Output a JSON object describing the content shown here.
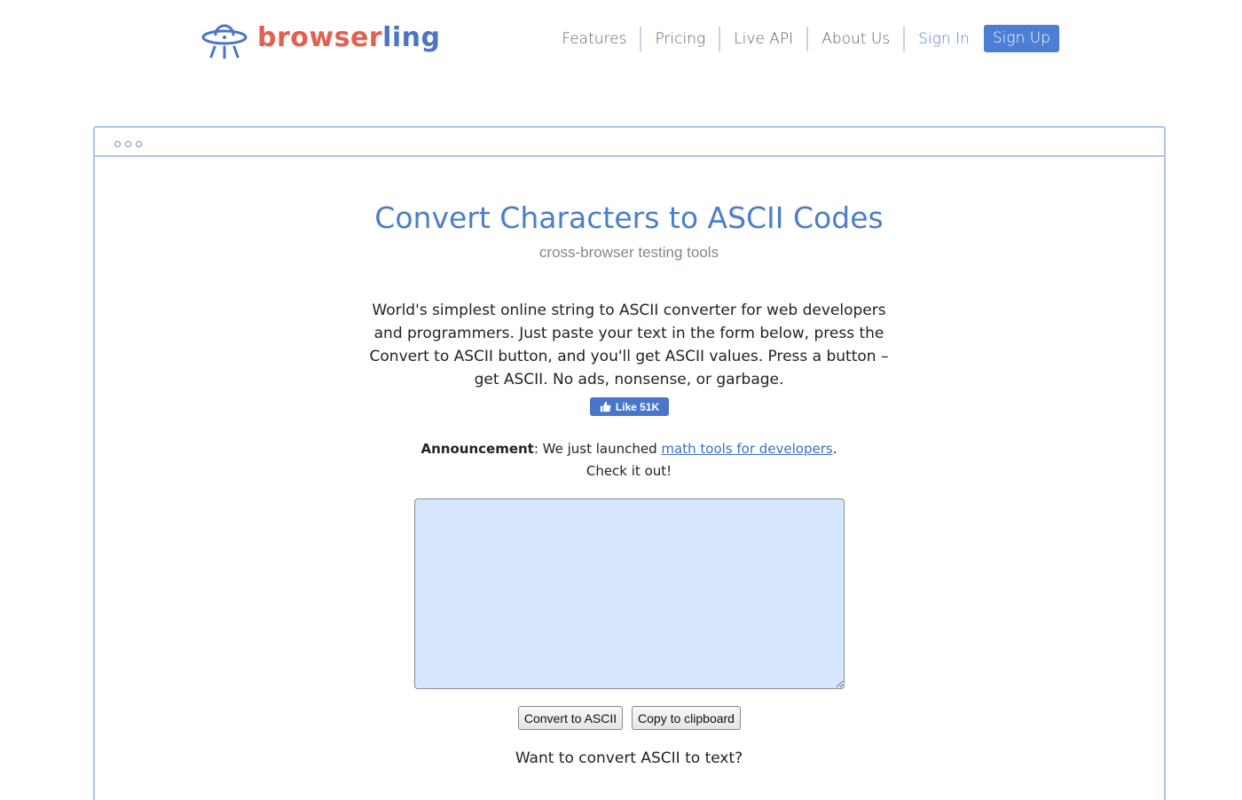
{
  "header": {
    "logo": {
      "part1": "browser",
      "part2": "ling",
      "icon": "ufo-icon"
    },
    "nav": [
      {
        "label": "Features"
      },
      {
        "label": "Pricing"
      },
      {
        "label": "Live API"
      },
      {
        "label": "About Us"
      }
    ],
    "sign_in": "Sign In",
    "sign_up": "Sign Up"
  },
  "main": {
    "title": "Convert Characters to ASCII Codes",
    "subtitle": "cross-browser testing tools",
    "description": "World's simplest online string to ASCII converter for web developers and programmers. Just paste your text in the form below, press the Convert to ASCII button, and you'll get ASCII values. Press a button – get ASCII. No ads, nonsense, or garbage.",
    "like_button": "Like 51K",
    "announcement": {
      "label": "Announcement",
      "text_before": ": We just launched ",
      "link": "math tools for developers",
      "text_after": ".",
      "line2": "Check it out!"
    },
    "input": {
      "value": ""
    },
    "convert_button": "Convert to ASCII",
    "copy_button": "Copy to clipboard",
    "footer_question": "Want to convert ASCII to text?"
  },
  "colors": {
    "brand_red": "#e4604f",
    "brand_blue": "#4a76c4",
    "accent": "#4b7fd3",
    "textarea_bg": "#d6e6fc"
  }
}
